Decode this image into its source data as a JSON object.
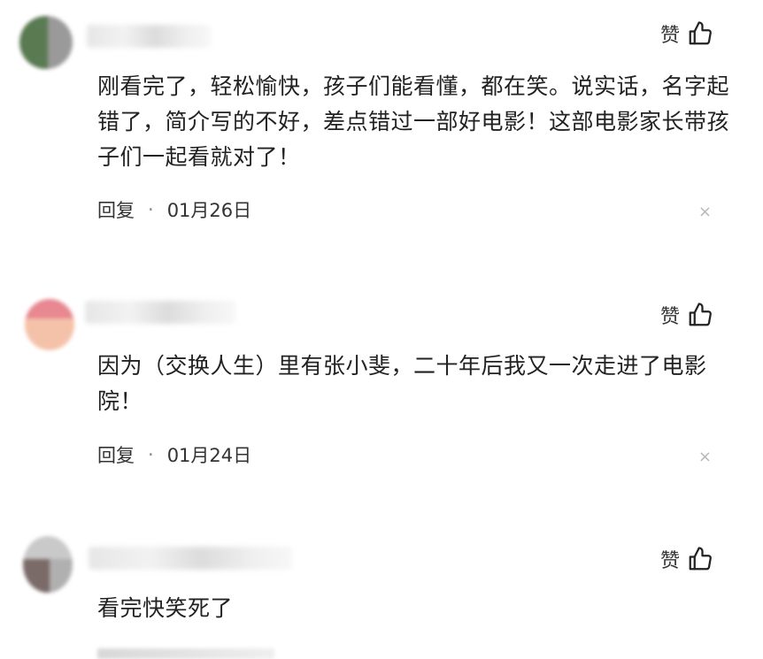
{
  "comments": [
    {
      "like_label": "赞",
      "text": "刚看完了，轻松愉快，孩子们能看懂，都在笑。说实话，名字起错了，简介写的不好，差点错过一部好电影！这部电影家长带孩子们一起看就对了！",
      "reply_label": "回复",
      "separator": "·",
      "date": "01月26日",
      "close_label": "×"
    },
    {
      "like_label": "赞",
      "text": "因为（交换人生）里有张小斐，二十年后我又一次走进了电影院！",
      "reply_label": "回复",
      "separator": "·",
      "date": "01月24日",
      "close_label": "×"
    },
    {
      "like_label": "赞",
      "text": "看完快笑死了"
    }
  ],
  "colors": {
    "background": "#ffffff",
    "text": "#222222",
    "meta": "#333333",
    "close": "#b8b8b8"
  },
  "icons": {
    "like": "thumbs-up-icon",
    "close": "close-icon",
    "avatar": "avatar"
  }
}
